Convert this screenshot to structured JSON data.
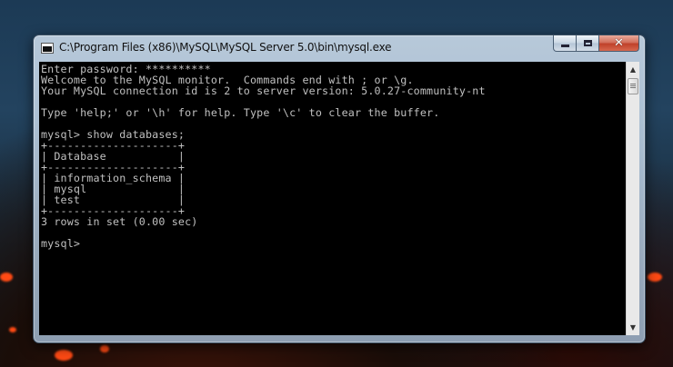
{
  "window": {
    "title": "C:\\Program Files (x86)\\MySQL\\MySQL Server 5.0\\bin\\mysql.exe",
    "icon": "console-app-icon",
    "controls": {
      "minimize": "minimize-icon",
      "maximize": "maximize-icon",
      "close": "close-icon"
    }
  },
  "console": {
    "lines": [
      "Enter password: **********",
      "Welcome to the MySQL monitor.  Commands end with ; or \\g.",
      "Your MySQL connection id is 2 to server version: 5.0.27-community-nt",
      "",
      "Type 'help;' or '\\h' for help. Type '\\c' to clear the buffer.",
      "",
      "mysql> show databases;",
      "+--------------------+",
      "| Database           |",
      "+--------------------+",
      "| information_schema |",
      "| mysql              |",
      "| test               |",
      "+--------------------+",
      "3 rows in set (0.00 sec)",
      "",
      "mysql>"
    ]
  },
  "scrollbar": {
    "up": "scroll-up-arrow-icon",
    "down": "scroll-down-arrow-icon"
  }
}
